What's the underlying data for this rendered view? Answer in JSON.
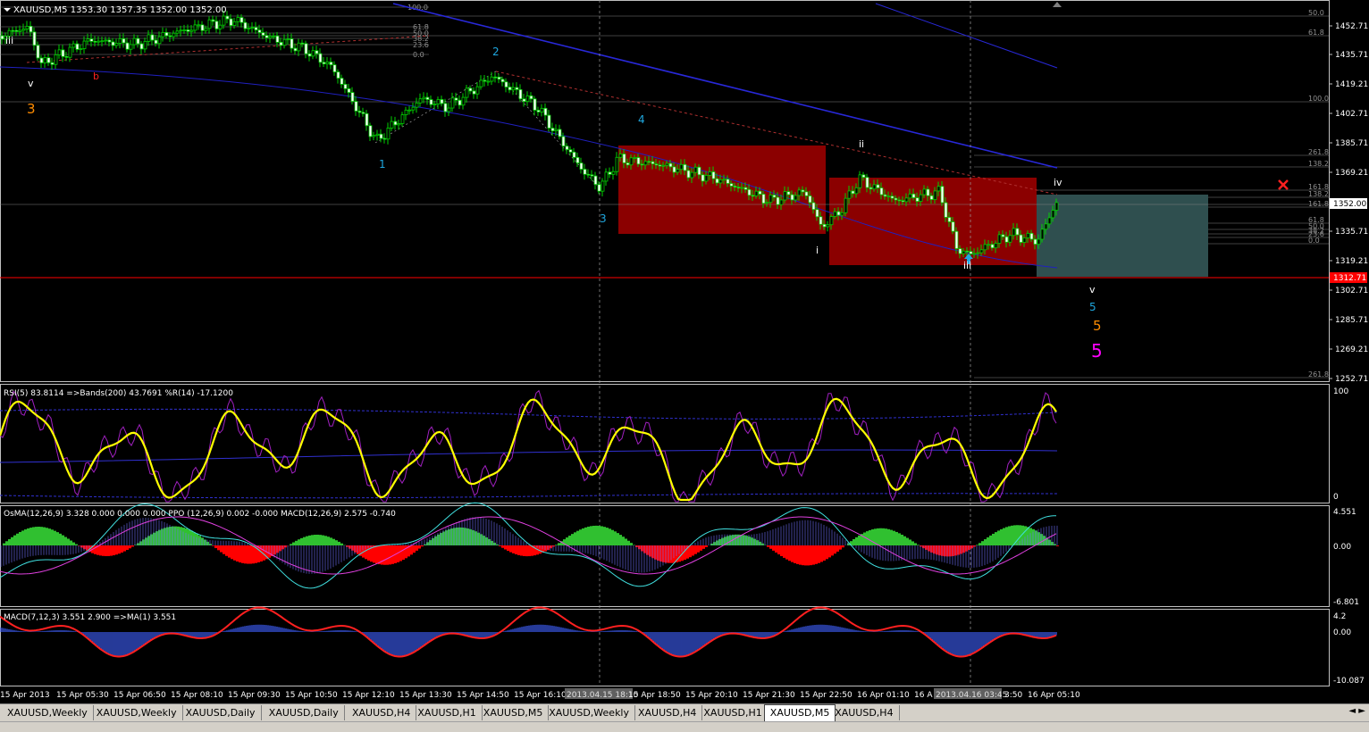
{
  "chart_header": "XAUUSD,M5  1353.30 1357.35 1352.00 1352.00",
  "price_axis": [
    "1452.71",
    "1435.71",
    "1419.21",
    "1402.71",
    "1385.71",
    "1369.21",
    "1335.71",
    "1319.21",
    "1302.71",
    "1285.71",
    "1269.21",
    "1252.71"
  ],
  "current_price": "1352.00",
  "red_line_price": "1312.71",
  "fib_left": [
    "100.0",
    "61.8",
    "50.0",
    "38.2",
    "23.6",
    "0.0"
  ],
  "fib_right": [
    "50.0",
    "61.8",
    "100.0",
    "261.8",
    "138.2",
    "161.8",
    "138.2",
    "161.8",
    "61.8",
    "50.0",
    "38.2",
    "23.6",
    "0.0",
    "261.8"
  ],
  "wave_labels": [
    {
      "text": "iii",
      "color": "#ffffff"
    },
    {
      "text": "v",
      "color": "#ffffff"
    },
    {
      "text": "b",
      "color": "#ff2020"
    },
    {
      "text": "3",
      "color": "#ff8c00"
    },
    {
      "text": "1",
      "color": "#1fa8e0"
    },
    {
      "text": "2",
      "color": "#1fa8e0"
    },
    {
      "text": "4",
      "color": "#1fa8e0"
    },
    {
      "text": "3",
      "color": "#1fa8e0"
    },
    {
      "text": "i",
      "color": "#ffffff"
    },
    {
      "text": "ii",
      "color": "#ffffff"
    },
    {
      "text": "iii",
      "color": "#ffffff"
    },
    {
      "text": "iv",
      "color": "#ffffff"
    },
    {
      "text": "v",
      "color": "#ffffff"
    },
    {
      "text": "5",
      "color": "#1fa8e0"
    },
    {
      "text": "5",
      "color": "#ff8c00"
    },
    {
      "text": "5",
      "color": "#ff00ff"
    }
  ],
  "rsi_header": "RSI(5) 83.8114  =>Bands(200) 43.7691  %R(14) -17.1200",
  "rsi_axis": [
    "100",
    "0"
  ],
  "osma_header": "OsMA(12,26,9) 3.328 0.000 0.000 0.000  PPO (12,26,9) 0.002 -0.000  MACD(12,26,9) 2.575 -0.740",
  "osma_axis": [
    "4.551",
    "0.00",
    "-6.801"
  ],
  "macd_header": "MACD(7,12,3) 3.551 2.900  =>MA(1) 3.551",
  "macd_axis": [
    "4.2",
    "0.00",
    "-10.087"
  ],
  "time_axis": [
    "15 Apr 2013",
    "15 Apr 05:30",
    "15 Apr 06:50",
    "15 Apr 08:10",
    "15 Apr 09:30",
    "15 Apr 10:50",
    "15 Apr 12:10",
    "15 Apr 13:30",
    "15 Apr 14:50",
    "15 Apr 16:10",
    "2013.04.15 18:10",
    "15 Apr 18:50",
    "15 Apr 20:10",
    "15 Apr 21:30",
    "15 Apr 22:50",
    "16 Apr 01:10",
    "16 A",
    "2013.04.16 03:45",
    "3:50",
    "16 Apr 05:10"
  ],
  "tabs": [
    "XAUUSD,Weekly",
    "XAUUSD,Weekly",
    "XAUUSD,Daily",
    "XAUUSD,Daily",
    "XAUUSD,H4",
    "XAUUSD,H1",
    "XAUUSD,M5",
    "XAUUSD,Weekly",
    "XAUUSD,H4",
    "XAUUSD,H1",
    "XAUUSD,M5",
    "XAUUSD,H4"
  ],
  "active_tab_index": 10,
  "colors": {
    "bull": "#00d000",
    "rsi": "#ffff00",
    "box": "#8b0000",
    "target": "#2f4f4f"
  }
}
